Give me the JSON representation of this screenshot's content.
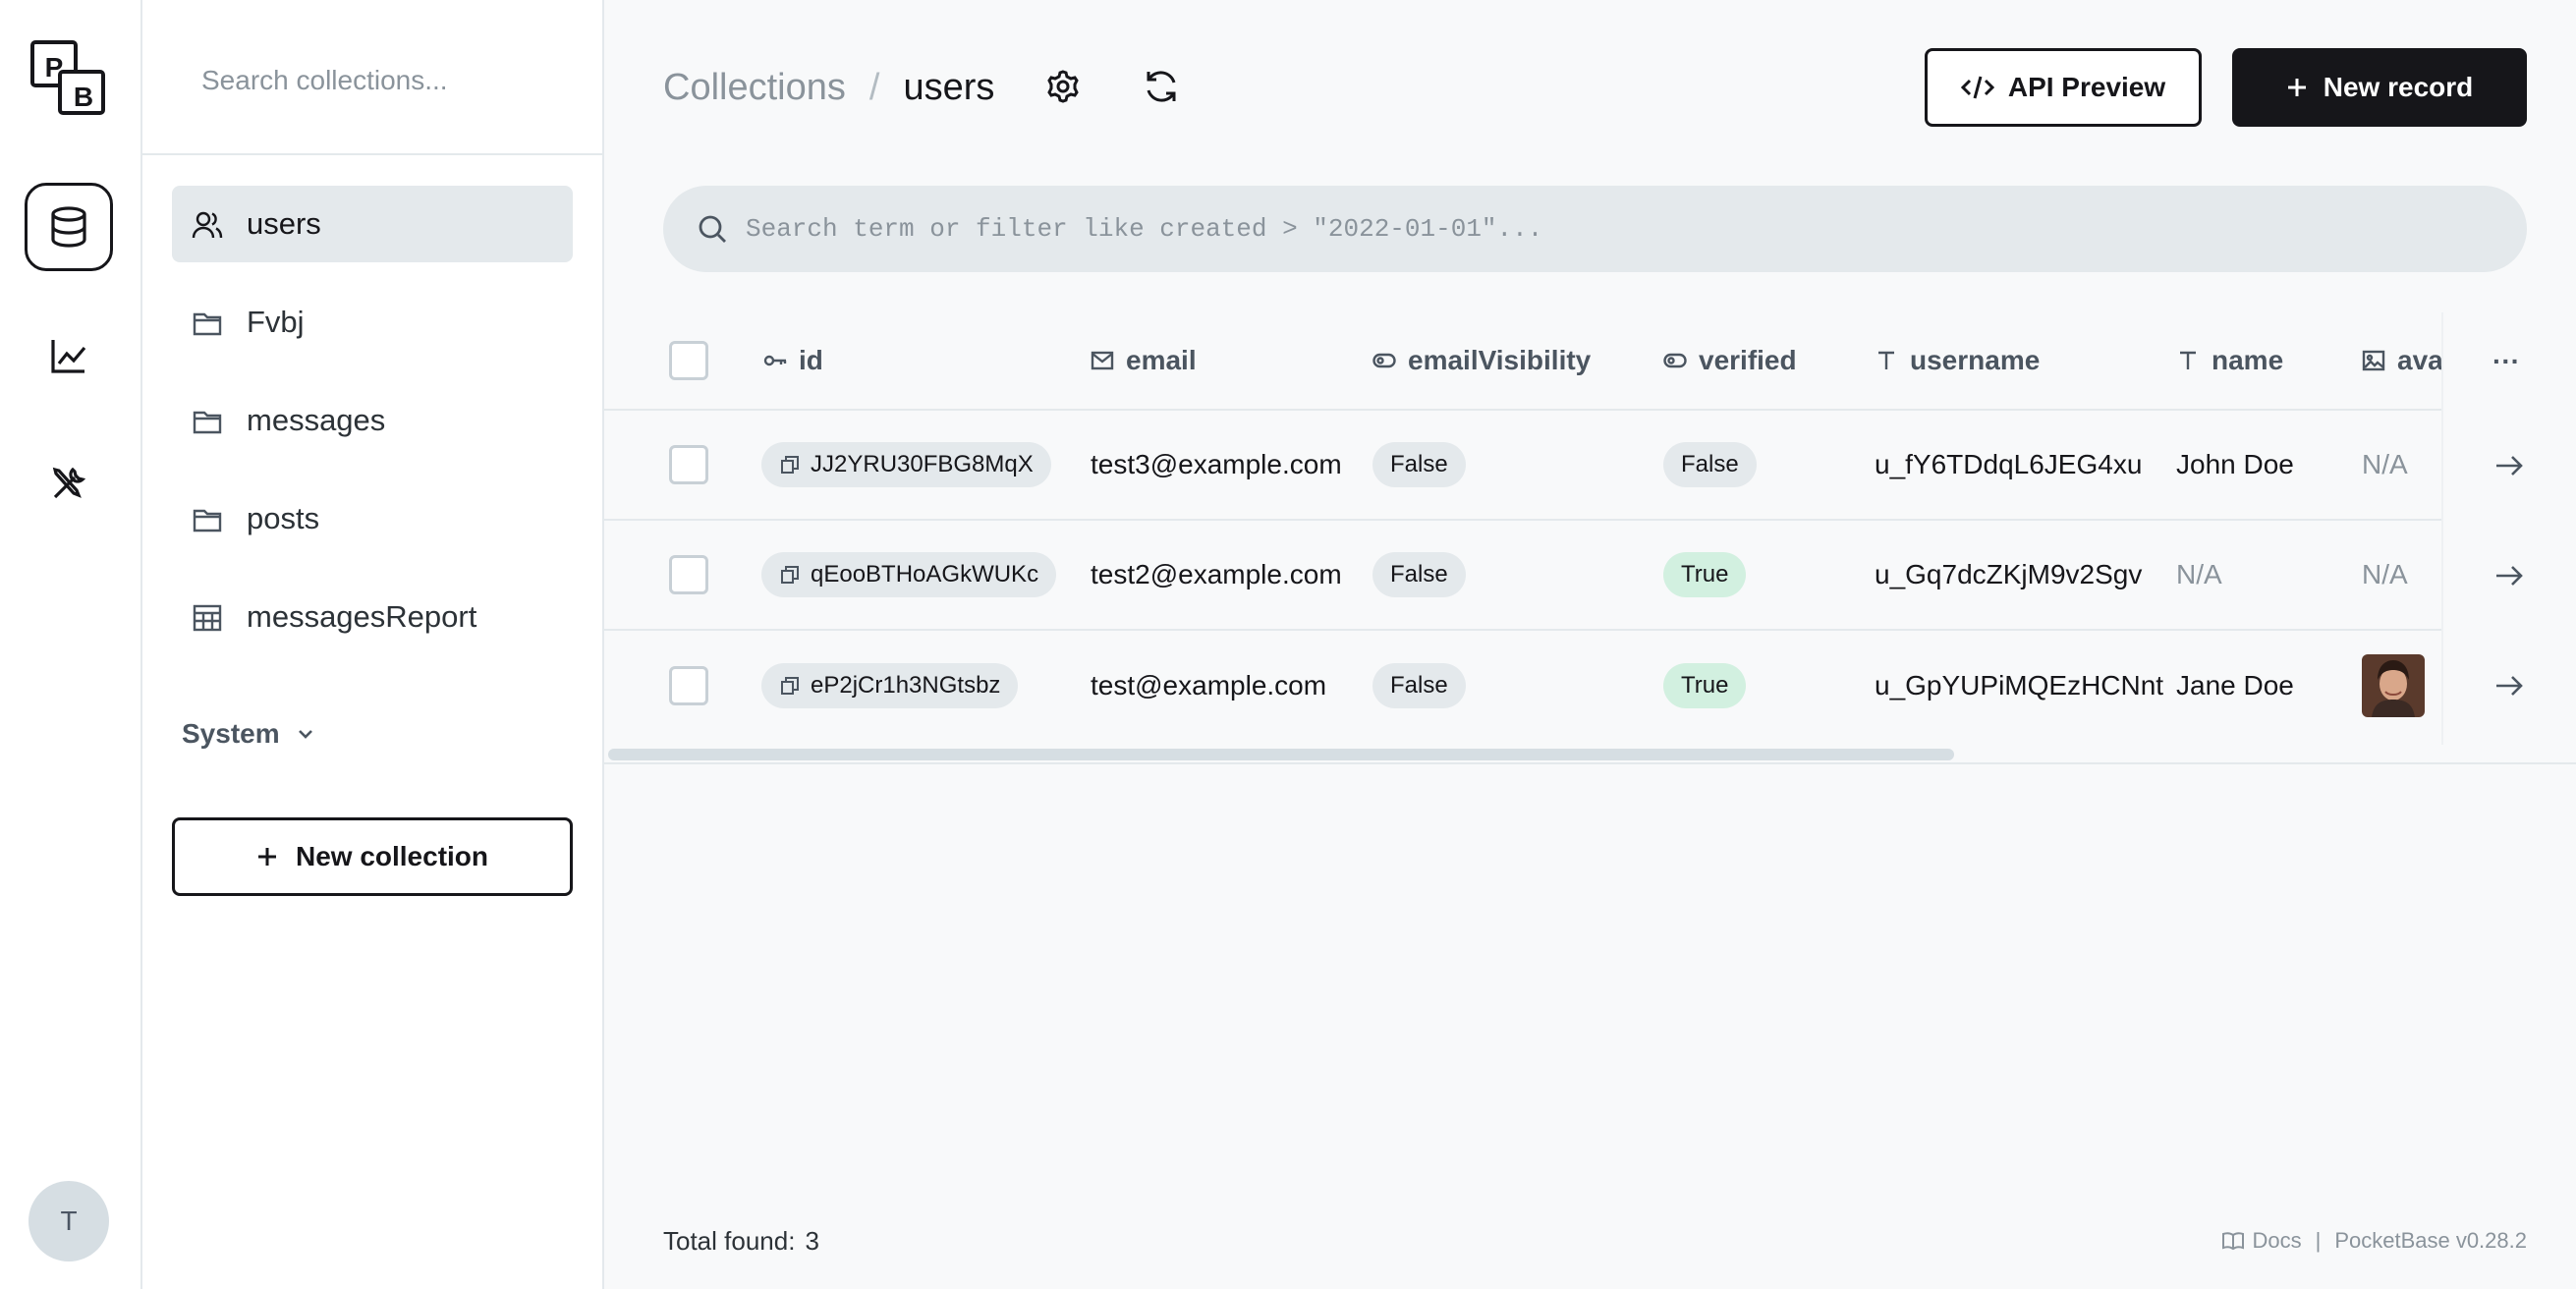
{
  "sidebar": {
    "search_placeholder": "Search collections...",
    "items": [
      {
        "label": "users",
        "icon": "users-icon",
        "active": true
      },
      {
        "label": "Fvbj",
        "icon": "folder-icon"
      },
      {
        "label": "messages",
        "icon": "folder-icon"
      },
      {
        "label": "posts",
        "icon": "folder-icon"
      },
      {
        "label": "messagesReport",
        "icon": "table-icon"
      }
    ],
    "system_label": "System",
    "new_collection_label": "New collection"
  },
  "rail": {
    "logo_letters": [
      "P",
      "B"
    ],
    "avatar_letter": "T"
  },
  "header": {
    "breadcrumb_parent": "Collections",
    "breadcrumb_separator": "/",
    "breadcrumb_current": "users",
    "api_preview_label": "API Preview",
    "new_record_label": "New record"
  },
  "search": {
    "placeholder": "Search term or filter like created > \"2022-01-01\"..."
  },
  "table": {
    "columns": [
      {
        "label": "id",
        "icon": "key-icon"
      },
      {
        "label": "email",
        "icon": "mail-icon"
      },
      {
        "label": "emailVisibility",
        "icon": "toggle-icon"
      },
      {
        "label": "verified",
        "icon": "toggle-icon"
      },
      {
        "label": "username",
        "icon": "text-icon"
      },
      {
        "label": "name",
        "icon": "text-icon"
      },
      {
        "label": "ava",
        "icon": "image-icon"
      }
    ],
    "more_label": "···",
    "rows": [
      {
        "id": "JJ2YRU30FBG8MqX",
        "email": "test3@example.com",
        "emailVisibility": "False",
        "verified": "False",
        "username": "u_fY6TDdqL6JEG4xu",
        "name": "John Doe",
        "avatar": "N/A"
      },
      {
        "id": "qEooBTHoAGkWUKc",
        "email": "test2@example.com",
        "emailVisibility": "False",
        "verified": "True",
        "username": "u_Gq7dcZKjM9v2Sgv",
        "name": "N/A",
        "avatar": "N/A"
      },
      {
        "id": "eP2jCr1h3NGtsbz",
        "email": "test@example.com",
        "emailVisibility": "False",
        "verified": "True",
        "username": "u_GpYUPiMQEzHCNnt",
        "name": "Jane Doe",
        "avatar": "image"
      }
    ]
  },
  "footer": {
    "total_label": "Total found:",
    "total_count": "3",
    "docs_label": "Docs",
    "separator": "|",
    "version": "PocketBase v0.28.2"
  },
  "colors": {
    "accent": "#16161a",
    "border": "#e4e9ec",
    "muted": "#8a939b",
    "success_bg": "#d2f0e0"
  }
}
